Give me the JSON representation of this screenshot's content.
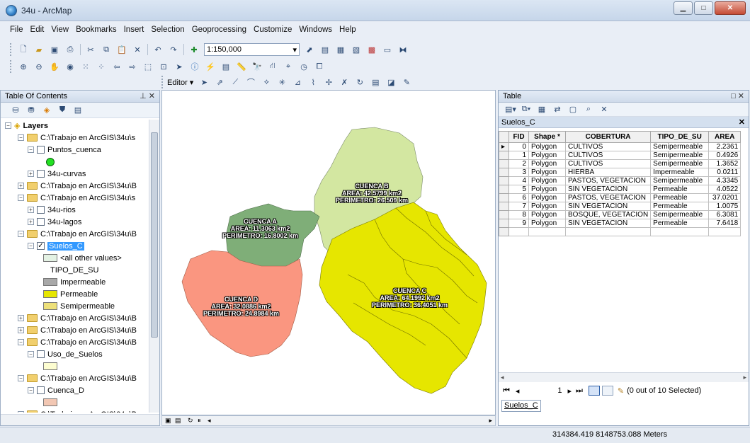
{
  "window": {
    "title": "34u - ArcMap",
    "minimize": "▁",
    "maximize": "□",
    "close": "✕"
  },
  "menu": [
    "File",
    "Edit",
    "View",
    "Bookmarks",
    "Insert",
    "Selection",
    "Geoprocessing",
    "Customize",
    "Windows",
    "Help"
  ],
  "toolbar": {
    "scale": "1:150,000",
    "editor_label": "Editor ▾"
  },
  "toc": {
    "title": "Table Of Contents",
    "pin": "⊥ ✕",
    "rows": [
      {
        "text": "Layers",
        "kind": "group"
      },
      {
        "text": "C:\\Trabajo en ArcGIS\\34u\\s",
        "kind": "folder"
      },
      {
        "text": "Puntos_cuenca",
        "kind": "layer"
      },
      {
        "text": "",
        "kind": "point-symbol"
      },
      {
        "text": "34u-curvas",
        "kind": "layer"
      },
      {
        "text": "C:\\Trabajo en ArcGIS\\34u\\B",
        "kind": "folder"
      },
      {
        "text": "C:\\Trabajo en ArcGIS\\34u\\s",
        "kind": "folder"
      },
      {
        "text": "34u-rios",
        "kind": "layer"
      },
      {
        "text": "34u-lagos",
        "kind": "layer"
      },
      {
        "text": "C:\\Trabajo en ArcGIS\\34u\\B",
        "kind": "folder"
      },
      {
        "text": "Suelos_C",
        "kind": "layer-selected"
      },
      {
        "text": "<all other values>",
        "kind": "legend",
        "color": "#e4f2e4"
      },
      {
        "text": "TIPO_DE_SU",
        "kind": "heading"
      },
      {
        "text": "Impermeable",
        "kind": "legend",
        "color": "#a8a8a8"
      },
      {
        "text": "Permeable",
        "kind": "legend",
        "color": "#e6e600"
      },
      {
        "text": "Semipermeable",
        "kind": "legend",
        "color": "#ede07a"
      },
      {
        "text": "C:\\Trabajo en ArcGIS\\34u\\B",
        "kind": "folder"
      },
      {
        "text": "C:\\Trabajo en ArcGIS\\34u\\B",
        "kind": "folder"
      },
      {
        "text": "C:\\Trabajo en ArcGIS\\34u\\B",
        "kind": "folder"
      },
      {
        "text": "Uso_de_Suelos",
        "kind": "layer"
      },
      {
        "text": "",
        "kind": "swatch-only",
        "color": "#fdfdd0"
      },
      {
        "text": "C:\\Trabajo en ArcGIS\\34u\\B",
        "kind": "folder"
      },
      {
        "text": "Cuenca_D",
        "kind": "layer"
      },
      {
        "text": "",
        "kind": "swatch-only",
        "color": "#f2c7b3"
      },
      {
        "text": "C:\\Trabajo en ArcGIS\\34u\\B",
        "kind": "folder"
      }
    ]
  },
  "map": {
    "labels": [
      {
        "name": "CUENCA B",
        "area": "AREA: 42.5799 km2",
        "perim": "PERIMETRO: 26.509 km"
      },
      {
        "name": "CUENCA A",
        "area": "AREA: 11.3063 km2",
        "perim": "PERIMETRO: 16.8002 km"
      },
      {
        "name": "CUENCA D",
        "area": "AREA: 32.0886 km2",
        "perim": "PERIMETRO: 24.8984 km"
      },
      {
        "name": "CUENCA C",
        "area": "AREA: 64.1992 km2",
        "perim": "PERIMETRO: 36.4051 km"
      }
    ],
    "colors": {
      "b": "#d3e7a1",
      "a": "#7fae78",
      "d": "#fa9680",
      "c": "#e6e600"
    }
  },
  "table": {
    "window_title": "Table",
    "window_btns": "□ ✕",
    "layer_name": "Suelos_C",
    "close": "✕",
    "columns": [
      "FID",
      "Shape *",
      "COBERTURA",
      "TIPO_DE_SU",
      "AREA"
    ],
    "rows": [
      [
        "0",
        "Polygon",
        "CULTIVOS",
        "Semipermeable",
        "2.2361"
      ],
      [
        "1",
        "Polygon",
        "CULTIVOS",
        "Semipermeable",
        "0.4926"
      ],
      [
        "2",
        "Polygon",
        "CULTIVOS",
        "Semipermeable",
        "1.3652"
      ],
      [
        "3",
        "Polygon",
        "HIERBA",
        "Impermeable",
        "0.0211"
      ],
      [
        "4",
        "Polygon",
        "PASTOS, VEGETACION",
        "Semipermeable",
        "4.3345"
      ],
      [
        "5",
        "Polygon",
        "SIN VEGETACION",
        "Permeable",
        "4.0522"
      ],
      [
        "6",
        "Polygon",
        "PASTOS, VEGETACION",
        "Permeable",
        "37.0201"
      ],
      [
        "7",
        "Polygon",
        "SIN VEGETACION",
        "Permeable",
        "1.0075"
      ],
      [
        "8",
        "Polygon",
        "BOSQUE, VEGETACION",
        "Semipermeable",
        "6.3081"
      ],
      [
        "9",
        "Polygon",
        "SIN VEGETACION",
        "Permeable",
        "7.6418"
      ]
    ],
    "current_record": "1",
    "selection_status": "(0 out of 10 Selected)",
    "tab_label": "Suelos_C"
  },
  "status": {
    "coordinates": "314384.419  8148753.088 Meters"
  }
}
